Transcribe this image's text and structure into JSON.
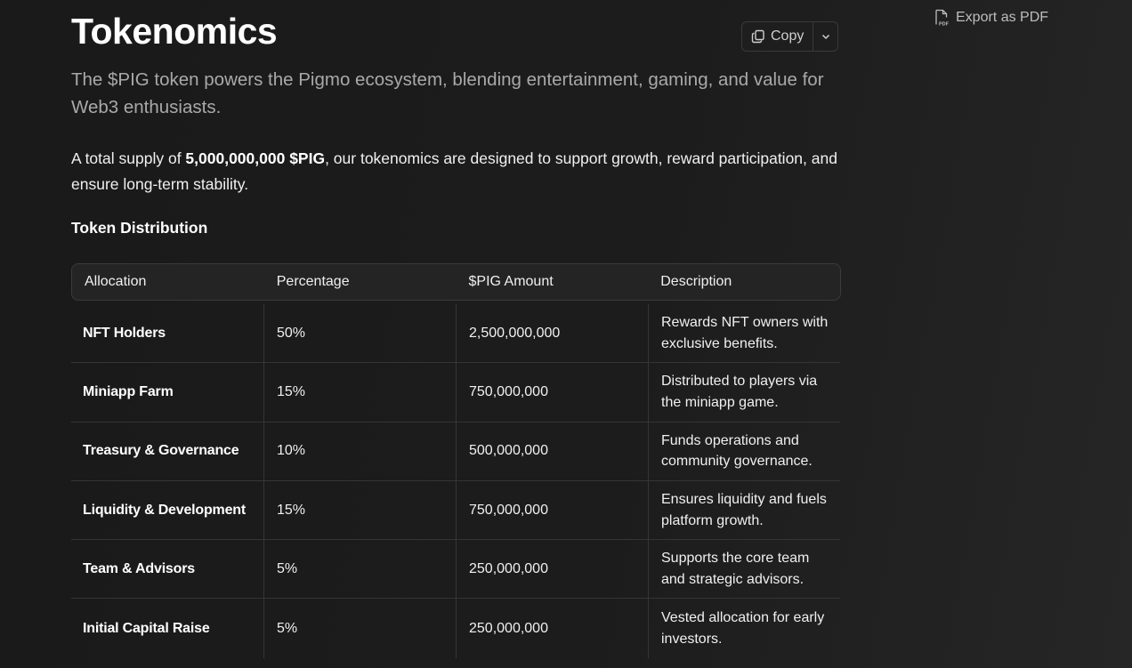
{
  "header": {
    "title": "Tokenomics",
    "copy_label": "Copy",
    "export_label": "Export as PDF"
  },
  "subtitle": "The $PIG token powers the Pigmo ecosystem, blending entertainment, gaming, and value for Web3 enthusiasts.",
  "intro": {
    "prefix": "A total supply of ",
    "bold": "5,000,000,000 $PIG",
    "suffix": ", our tokenomics are designed to support growth, reward participation, and ensure long-term stability."
  },
  "section_heading": "Token Distribution",
  "table": {
    "columns": [
      "Allocation",
      "Percentage",
      "$PIG Amount",
      "Description"
    ],
    "rows": [
      {
        "allocation": "NFT Holders",
        "percentage": "50%",
        "amount": "2,500,000,000",
        "description": "Rewards NFT owners with exclusive benefits."
      },
      {
        "allocation": "Miniapp Farm",
        "percentage": "15%",
        "amount": "750,000,000",
        "description": "Distributed to players via the miniapp game."
      },
      {
        "allocation": "Treasury & Governance",
        "percentage": "10%",
        "amount": "500,000,000",
        "description": "Funds operations and community governance."
      },
      {
        "allocation": "Liquidity & Development",
        "percentage": "15%",
        "amount": "750,000,000",
        "description": "Ensures liquidity and fuels platform growth."
      },
      {
        "allocation": "Team & Advisors",
        "percentage": "5%",
        "amount": "250,000,000",
        "description": "Supports the core team and strategic advisors."
      },
      {
        "allocation": "Initial Capital Raise",
        "percentage": "5%",
        "amount": "250,000,000",
        "description": "Vested allocation for early investors."
      }
    ]
  },
  "icons": {
    "copy": "copy-icon",
    "caret": "chevron-down-icon",
    "export": "pdf-file-icon"
  }
}
